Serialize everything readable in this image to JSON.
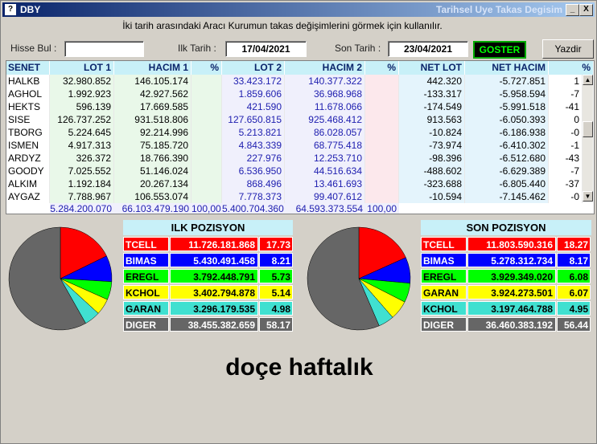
{
  "window": {
    "title": "DBY",
    "right_title": "Tarihsel Uye Takas Degisim",
    "app_icon": "?",
    "minimize": "_",
    "close": "X"
  },
  "hint": "İki tarih arasındaki  Aracı Kurumun takas değişimlerini görmek için kullanılır.",
  "search": {
    "label": "Hisse Bul :",
    "value": ""
  },
  "start_date": {
    "label": "Ilk Tarih :",
    "value": "17/04/2021"
  },
  "end_date": {
    "label": "Son Tarih :",
    "value": "23/04/2021"
  },
  "show_button": "GOSTER",
  "print_button": "Yazdir",
  "table": {
    "headers": [
      "SENET",
      "LOT 1",
      "HACIM 1",
      "%",
      "LOT 2",
      "HACIM 2",
      "%",
      "NET LOT",
      "NET HACIM",
      "%"
    ],
    "rows": [
      [
        "HALKB",
        "32.980.852",
        "146.105.174",
        "",
        "33.423.172",
        "140.377.322",
        "",
        "442.320",
        "-5.727.851",
        "1"
      ],
      [
        "AGHOL",
        "1.992.923",
        "42.927.562",
        "",
        "1.859.606",
        "36.968.968",
        "",
        "-133.317",
        "-5.958.594",
        "-7"
      ],
      [
        "HEKTS",
        "596.139",
        "17.669.585",
        "",
        "421.590",
        "11.678.066",
        "",
        "-174.549",
        "-5.991.518",
        "-41"
      ],
      [
        "SISE",
        "126.737.252",
        "931.518.806",
        "",
        "127.650.815",
        "925.468.412",
        "",
        "913.563",
        "-6.050.393",
        "0"
      ],
      [
        "TBORG",
        "5.224.645",
        "92.214.996",
        "",
        "5.213.821",
        "86.028.057",
        "",
        "-10.824",
        "-6.186.938",
        "-0"
      ],
      [
        "ISMEN",
        "4.917.313",
        "75.185.720",
        "",
        "4.843.339",
        "68.775.418",
        "",
        "-73.974",
        "-6.410.302",
        "-1"
      ],
      [
        "ARDYZ",
        "326.372",
        "18.766.390",
        "",
        "227.976",
        "12.253.710",
        "",
        "-98.396",
        "-6.512.680",
        "-43"
      ],
      [
        "GOODY",
        "7.025.552",
        "51.146.024",
        "",
        "6.536.950",
        "44.516.634",
        "",
        "-488.602",
        "-6.629.389",
        "-7"
      ],
      [
        "ALKIM",
        "1.192.184",
        "20.267.134",
        "",
        "868.496",
        "13.461.693",
        "",
        "-323.688",
        "-6.805.440",
        "-37"
      ],
      [
        "AYGAZ",
        "7.788.967",
        "106.553.074",
        "",
        "7.778.373",
        "99.407.612",
        "",
        "-10.594",
        "-7.145.462",
        "-0"
      ]
    ],
    "totals": [
      "",
      "5.284.200.070",
      "66.103.479.190",
      "100,00",
      "5.400.704.360",
      "64.593.373.554",
      "100,00",
      "",
      "",
      ""
    ]
  },
  "ilk_pozisyon": {
    "title": "ILK POZISYON",
    "rows": [
      {
        "name": "TCELL",
        "value": "11.726.181.868",
        "pct": "17.73",
        "pct_num": 17.73,
        "bg": "#ff0000",
        "fg": "#ffffff"
      },
      {
        "name": "BIMAS",
        "value": "5.430.491.458",
        "pct": "8.21",
        "pct_num": 8.21,
        "bg": "#0000ff",
        "fg": "#ffffff"
      },
      {
        "name": "EREGL",
        "value": "3.792.448.791",
        "pct": "5.73",
        "pct_num": 5.73,
        "bg": "#00ff00",
        "fg": "#000000"
      },
      {
        "name": "KCHOL",
        "value": "3.402.794.878",
        "pct": "5.14",
        "pct_num": 5.14,
        "bg": "#ffff00",
        "fg": "#000000"
      },
      {
        "name": "GARAN",
        "value": "3.296.179.535",
        "pct": "4.98",
        "pct_num": 4.98,
        "bg": "#40e0d0",
        "fg": "#000000"
      },
      {
        "name": "DIGER",
        "value": "38.455.382.659",
        "pct": "58.17",
        "pct_num": 58.17,
        "bg": "#666666",
        "fg": "#ffffff"
      }
    ]
  },
  "son_pozisyon": {
    "title": "SON POZISYON",
    "rows": [
      {
        "name": "TCELL",
        "value": "11.803.590.316",
        "pct": "18.27",
        "pct_num": 18.27,
        "bg": "#ff0000",
        "fg": "#ffffff"
      },
      {
        "name": "BIMAS",
        "value": "5.278.312.734",
        "pct": "8.17",
        "pct_num": 8.17,
        "bg": "#0000ff",
        "fg": "#ffffff"
      },
      {
        "name": "EREGL",
        "value": "3.929.349.020",
        "pct": "6.08",
        "pct_num": 6.08,
        "bg": "#00ff00",
        "fg": "#000000"
      },
      {
        "name": "GARAN",
        "value": "3.924.273.501",
        "pct": "6.07",
        "pct_num": 6.07,
        "bg": "#ffff00",
        "fg": "#000000"
      },
      {
        "name": "KCHOL",
        "value": "3.197.464.788",
        "pct": "4.95",
        "pct_num": 4.95,
        "bg": "#40e0d0",
        "fg": "#000000"
      },
      {
        "name": "DIGER",
        "value": "36.460.383.192",
        "pct": "56.44",
        "pct_num": 56.44,
        "bg": "#666666",
        "fg": "#ffffff"
      }
    ]
  },
  "watermark": "doçe haftalık"
}
